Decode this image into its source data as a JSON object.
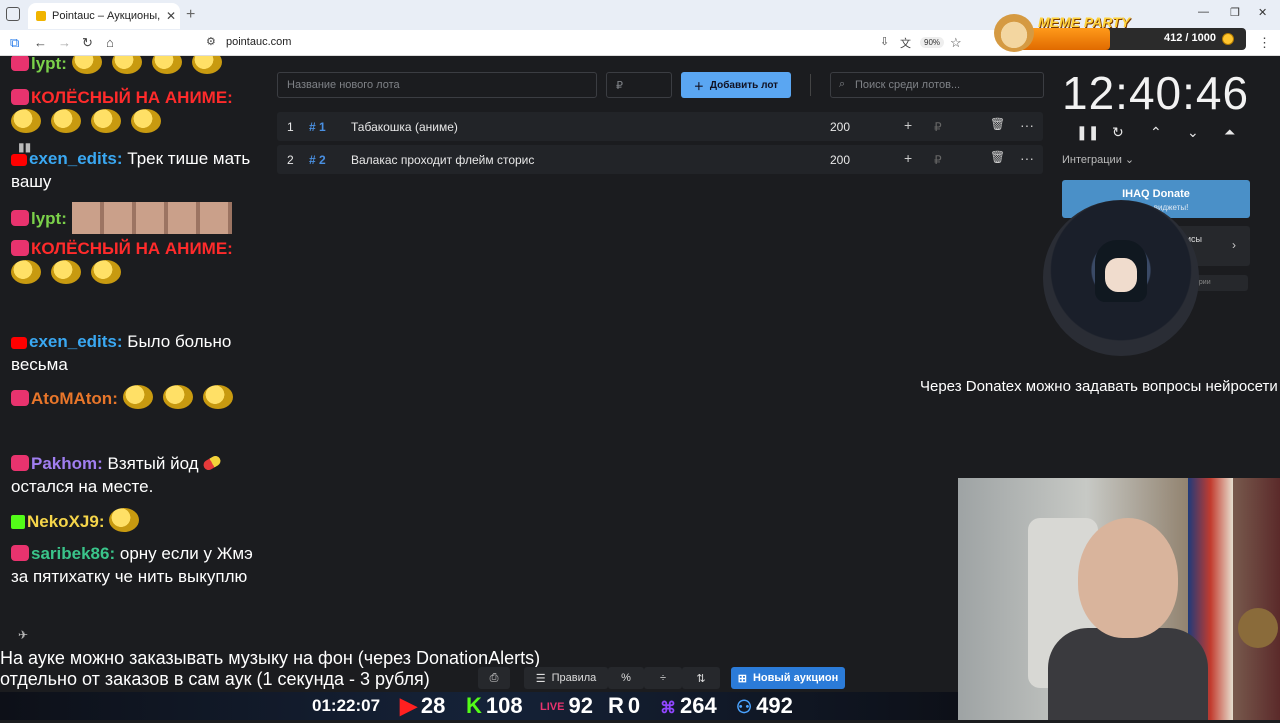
{
  "browser": {
    "tab_title": "Pointauc – Аукционы, лотереи",
    "url": "pointauc.com",
    "zoom": "90%"
  },
  "meme_party": {
    "logo": "MEME PARTY",
    "count": "412 / 1000",
    "progress": 0.412
  },
  "chat": [
    {
      "nick": "lypt:",
      "text": "",
      "nick_color": "#7bd14a"
    },
    {
      "nick": "КОЛЁСНЫЙ НА АНИМЕ:",
      "text": "",
      "nick_color": "#ff2b2b"
    },
    {
      "nick": "exen_edits:",
      "text": "Трек тише мать вашу",
      "nick_color": "#3aa8f2"
    },
    {
      "nick": "lypt:",
      "text": "",
      "nick_color": "#7bd14a"
    },
    {
      "nick": "КОЛЁСНЫЙ НА АНИМЕ:",
      "text": "",
      "nick_color": "#ff2b2b"
    },
    {
      "nick": "exen_edits:",
      "text": "Было больно весьма",
      "nick_color": "#3aa8f2"
    },
    {
      "nick": "AtoMAton:",
      "text": "",
      "nick_color": "#e8762a"
    },
    {
      "nick": "Pakhom:",
      "text": "Взятый йод",
      "nick_color": "#a07ef0"
    },
    {
      "nick": "",
      "text": "остался на месте.",
      "nick_color": "#fff"
    },
    {
      "nick": "NekoXJ9:",
      "text": "",
      "nick_color": "#f5d54a"
    },
    {
      "nick": "saribek86:",
      "text": "орну если у Жмэ за пятихатку че нить выкуплю",
      "nick_color": "#3ac48a"
    }
  ],
  "main": {
    "lot_name_placeholder": "Название нового лота",
    "amount_placeholder": "₽",
    "add_lot": "Добавить лот",
    "search_placeholder": "Поиск среди лотов...",
    "lots": [
      {
        "index": "1",
        "id": "# 1",
        "name": "Табакошка (аниме)",
        "amount": "200",
        "plus": "+",
        "currency": "₽",
        "trash": "🗑",
        "more": "···"
      },
      {
        "index": "2",
        "id": "# 2",
        "name": "Валакас проходит флейм сторис",
        "amount": "200",
        "plus": "+",
        "currency": "₽",
        "trash": "🗑",
        "more": "···"
      }
    ]
  },
  "timer": {
    "time": "12:40:46",
    "integrations": "Интеграции",
    "donate_title": "IHAQ Donate",
    "donate_sub": "альные виджеты!",
    "box2_text": "исы",
    "box3_text": "ории"
  },
  "donatex_text": "Через Donatex можно задавать вопросы нейросети",
  "bottom": {
    "line1": "На ауке можно заказывать музыку на фон (через DonationAlerts)",
    "line2": "отдельно от заказов в сам аук (1 секунда - 3 рубля)",
    "rules": "Правила",
    "new_auction": "Новый аукцион"
  },
  "stats": {
    "uptime": "01:22:07",
    "youtube": "28",
    "kick": "108",
    "vk": "92",
    "r": "0",
    "twitch": "264",
    "viewers": "492"
  }
}
